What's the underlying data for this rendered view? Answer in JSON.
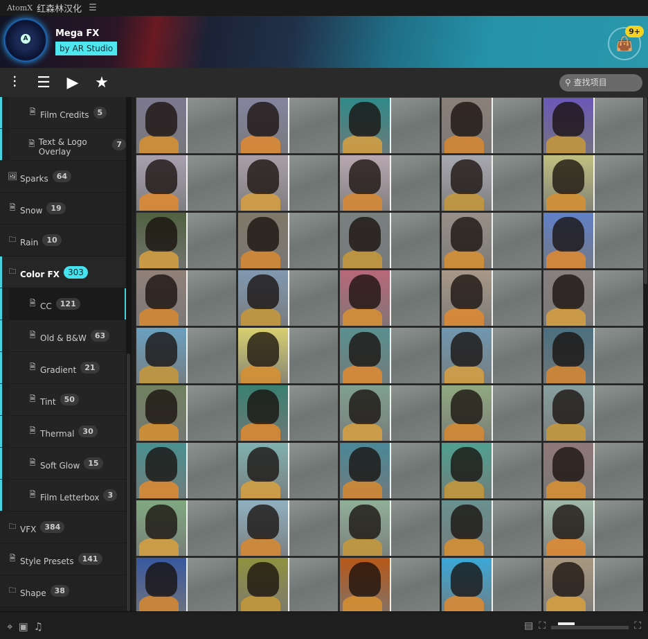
{
  "titlebar": {
    "app": "AtomX",
    "name": "红森林汉化",
    "menu_icon": "hamburger-icon"
  },
  "banner": {
    "title": "Mega FX",
    "subtitle": "by AR Studio",
    "logo_letter": "A",
    "cart_badge": "9+"
  },
  "toolbar": {
    "search_placeholder": "查找项目"
  },
  "sidebar": {
    "items": [
      {
        "label": "Film Credits",
        "count": "5",
        "icon": "AE",
        "level": "sub"
      },
      {
        "label": "Text & Logo Overlay",
        "count": "7",
        "icon": "AE",
        "level": "sub"
      },
      {
        "label": "Sparks",
        "count": "64",
        "icon": "image",
        "level": "top"
      },
      {
        "label": "Snow",
        "count": "19",
        "icon": "AE",
        "level": "top"
      },
      {
        "label": "Rain",
        "count": "10",
        "icon": "folder",
        "level": "top"
      },
      {
        "label": "Color FX",
        "count": "303",
        "icon": "folder",
        "level": "top",
        "active": true
      },
      {
        "label": "CC",
        "count": "121",
        "icon": "doc",
        "level": "sub",
        "selected": true
      },
      {
        "label": "Old & B&W",
        "count": "63",
        "icon": "doc",
        "level": "sub"
      },
      {
        "label": "Gradient",
        "count": "21",
        "icon": "doc",
        "level": "sub"
      },
      {
        "label": "Tint",
        "count": "50",
        "icon": "doc",
        "level": "sub"
      },
      {
        "label": "Thermal",
        "count": "30",
        "icon": "doc",
        "level": "sub"
      },
      {
        "label": "Soft Glow",
        "count": "15",
        "icon": "AE",
        "level": "sub"
      },
      {
        "label": "Film Letterbox",
        "count": "3",
        "icon": "AE",
        "level": "sub"
      },
      {
        "label": "VFX",
        "count": "384",
        "icon": "folder",
        "level": "top"
      },
      {
        "label": "Style Presets",
        "count": "141",
        "icon": "doc",
        "level": "top"
      },
      {
        "label": "Shape",
        "count": "38",
        "icon": "folder",
        "level": "top"
      }
    ]
  },
  "thumbnails": {
    "tints": [
      [
        "#7c7890",
        "#8484a0",
        "#2f8a8a",
        "#8c8078",
        "#6a58b8"
      ],
      [
        "#a8a0b0",
        "#a8a0a8",
        "#b8a8b0",
        "#a8a8b0",
        "#c0c080"
      ],
      [
        "#506040",
        "#807868",
        "#788080",
        "#989088",
        "#6080c8"
      ],
      [
        "#908078",
        "#8098b0",
        "#b86878",
        "#a89888",
        "#888080"
      ],
      [
        "#6aa0c0",
        "#d8d070",
        "#5a9090",
        "#7098b0",
        "#4a7080"
      ],
      [
        "#708060",
        "#3a8070",
        "#80a090",
        "#90a880",
        "#88a0a0"
      ],
      [
        "#4a9090",
        "#80b0b0",
        "#4a8898",
        "#50a090",
        "#907878"
      ],
      [
        "#80a880",
        "#90b0c0",
        "#90b098",
        "#6a9090",
        "#a0b8a8"
      ],
      [
        "#3858a0",
        "#909040",
        "#b85818",
        "#3aa8d8",
        "#a89880"
      ]
    ],
    "coats": [
      "#d89030",
      "#e08a30",
      "#d8a040",
      "#d88830",
      "#c89838"
    ]
  }
}
